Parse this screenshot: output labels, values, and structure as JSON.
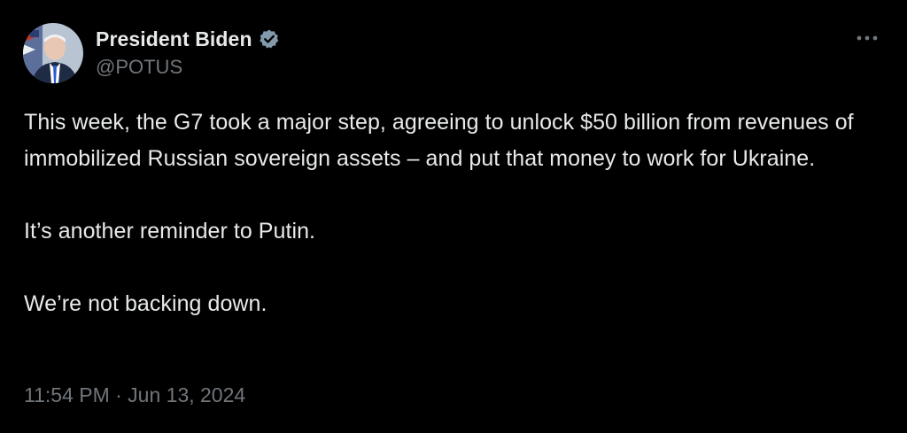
{
  "author": {
    "name": "President Biden",
    "handle": "@POTUS",
    "verified": true,
    "verified_color": "#829aab"
  },
  "tweet": {
    "paragraphs": [
      "This week, the G7 took a major step, agreeing to unlock $50 billion from revenues of immobilized Russian sovereign assets – and put that money to work for Ukraine.",
      "It’s another reminder to Putin.",
      "We’re not backing down."
    ],
    "timestamp": "11:54 PM · Jun 13, 2024"
  },
  "icons": {
    "more": "more-horizontal-icon",
    "badge": "verified-badge-icon"
  },
  "colors": {
    "background": "#000000",
    "text": "#e7e9ea",
    "secondary": "#71767b"
  }
}
